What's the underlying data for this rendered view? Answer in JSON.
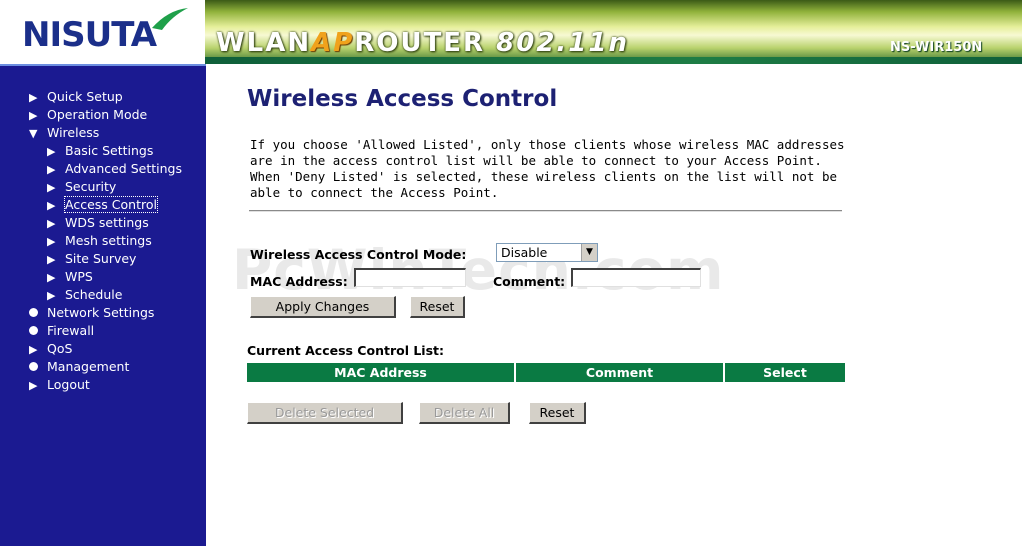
{
  "header": {
    "logo_text": "NISUTA",
    "banner_prefix": "WLAN",
    "banner_ap": "AP",
    "banner_router": "ROUTER",
    "banner_speed": "802.11n",
    "model": "NS-WIR150N"
  },
  "sidebar": {
    "items": [
      {
        "label": "Quick Setup",
        "marker": "arrow"
      },
      {
        "label": "Operation Mode",
        "marker": "arrow"
      },
      {
        "label": "Wireless",
        "marker": "arrow"
      },
      {
        "label": "Basic Settings",
        "marker": "arrow"
      },
      {
        "label": "Advanced Settings",
        "marker": "arrow"
      },
      {
        "label": "Security",
        "marker": "arrow"
      },
      {
        "label": "Access Control",
        "marker": "arrow",
        "active": true
      },
      {
        "label": "WDS settings",
        "marker": "arrow"
      },
      {
        "label": "Mesh settings",
        "marker": "arrow"
      },
      {
        "label": "Site Survey",
        "marker": "arrow"
      },
      {
        "label": "WPS",
        "marker": "arrow"
      },
      {
        "label": "Schedule",
        "marker": "arrow"
      },
      {
        "label": "Network Settings",
        "marker": "dot"
      },
      {
        "label": "Firewall",
        "marker": "dot"
      },
      {
        "label": "QoS",
        "marker": "arrow"
      },
      {
        "label": "Management",
        "marker": "dot"
      },
      {
        "label": "Logout",
        "marker": "arrow"
      }
    ]
  },
  "main": {
    "title": "Wireless Access Control",
    "intro": "If you choose 'Allowed Listed', only those clients whose wireless MAC addresses are in the access control list will be able to connect to your Access Point. When 'Deny Listed' is selected, these wireless clients on the list will not be able to connect the Access Point.",
    "watermark": "PcWinTech.com",
    "form": {
      "mode_label": "Wireless Access Control Mode:",
      "mode_value": "Disable",
      "mac_label": "MAC Address:",
      "mac_value": "",
      "comment_label": "Comment:",
      "comment_value": "",
      "apply_label": "Apply Changes",
      "reset_label": "Reset"
    },
    "list": {
      "title": "Current Access Control List:",
      "columns": [
        "MAC Address",
        "Comment",
        "Select"
      ],
      "rows": []
    },
    "actions": {
      "delete_selected": "Delete Selected",
      "delete_all": "Delete All",
      "reset": "Reset"
    }
  },
  "colors": {
    "sidebar_bg": "#1b1a91",
    "table_header": "#0a7a43",
    "title": "#1d2173"
  }
}
